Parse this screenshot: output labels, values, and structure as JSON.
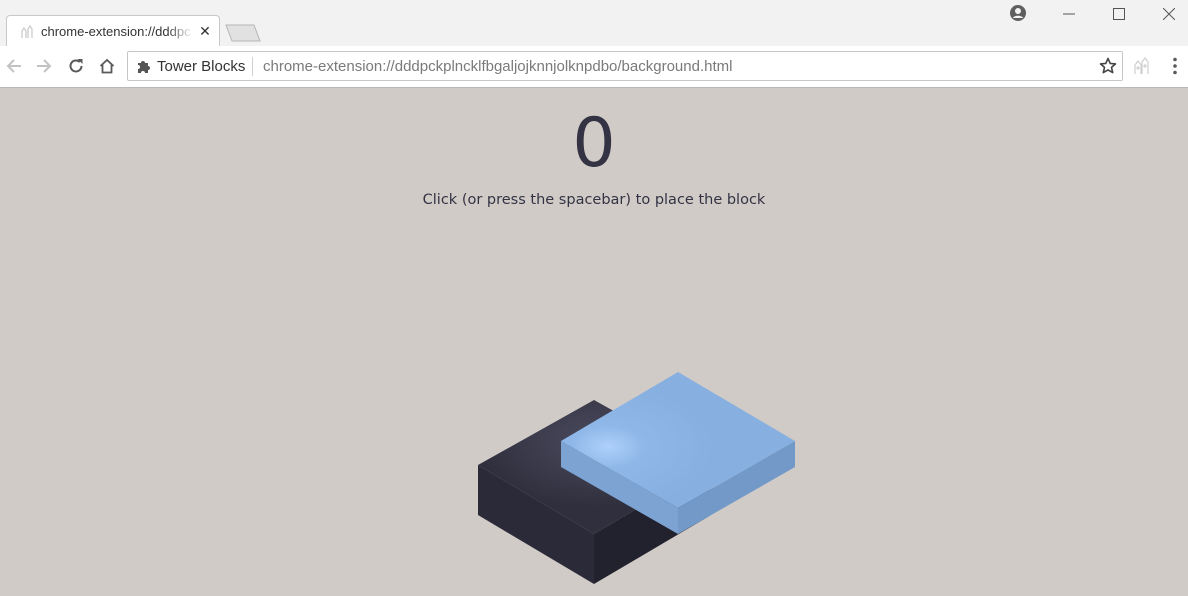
{
  "browser": {
    "tab": {
      "title": "chrome-extension://dddpckplncklfbgaljojknnjolknpdbo/background.html",
      "close_glyph": "✕",
      "favicon": "extension-favicon-icon"
    },
    "window_controls": [
      "minimize-icon",
      "maximize-icon",
      "close-icon"
    ],
    "toolbar": {
      "icons": [
        "back-arrow-icon",
        "forward-arrow-icon",
        "reload-icon",
        "home-icon"
      ],
      "extension_name": "Tower Blocks",
      "url": "chrome-extension://dddpckplncklfbgaljojknnjolknpdbo/background.html",
      "right_icons": [
        "bookmark-star-icon",
        "extension-icon",
        "menu-icon"
      ]
    }
  },
  "game": {
    "score": "0",
    "instructions": "Click (or press the spacebar) to place the block",
    "colors": {
      "background": "#d1cbc7",
      "base_block": "#333344",
      "moving_block": "#8ab0df",
      "text": "#333344"
    }
  }
}
